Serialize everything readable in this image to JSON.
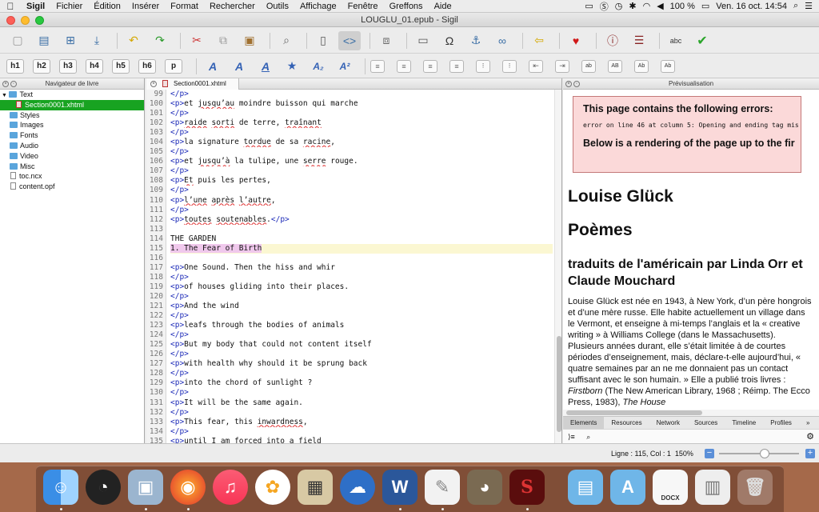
{
  "menubar": {
    "app_name": "Sigil",
    "items": [
      "Fichier",
      "Édition",
      "Insérer",
      "Format",
      "Rechercher",
      "Outils",
      "Affichage",
      "Fenêtre",
      "Greffons",
      "Aide"
    ],
    "battery": "100 %",
    "datetime": "Ven. 16 oct.  14:54"
  },
  "window": {
    "title": "LOUGLU_01.epub - Sigil"
  },
  "toolbar2": {
    "headings": [
      "h1",
      "h2",
      "h3",
      "h4",
      "h5",
      "h6",
      "p"
    ]
  },
  "book_browser": {
    "title": "Navigateur de livre",
    "items": [
      {
        "label": "Text",
        "type": "folder",
        "expanded": true
      },
      {
        "label": "Section0001.xhtml",
        "type": "file",
        "selected": true
      },
      {
        "label": "Styles",
        "type": "folder"
      },
      {
        "label": "Images",
        "type": "folder"
      },
      {
        "label": "Fonts",
        "type": "folder"
      },
      {
        "label": "Audio",
        "type": "folder"
      },
      {
        "label": "Video",
        "type": "folder"
      },
      {
        "label": "Misc",
        "type": "folder"
      },
      {
        "label": "toc.ncx",
        "type": "file"
      },
      {
        "label": "content.opf",
        "type": "file"
      }
    ]
  },
  "editor": {
    "tab_label": "Section0001.xhtml",
    "current_line": 115,
    "lines": [
      {
        "n": "99",
        "text": "</p>"
      },
      {
        "n": "100",
        "text": "<p>et jusqu’au moindre buisson qui marche"
      },
      {
        "n": "101",
        "text": "</p>"
      },
      {
        "n": "102",
        "text": "<p>raide sorti de terre, traînant"
      },
      {
        "n": "103",
        "text": "</p>"
      },
      {
        "n": "104",
        "text": "<p>la signature tordue de sa racine,"
      },
      {
        "n": "105",
        "text": "</p>"
      },
      {
        "n": "106",
        "text": "<p>et jusqu’à la tulipe, une serre rouge."
      },
      {
        "n": "107",
        "text": "</p>"
      },
      {
        "n": "108",
        "text": "<p>Et puis les pertes,"
      },
      {
        "n": "109",
        "text": "</p>"
      },
      {
        "n": "110",
        "text": "<p>l’une après l’autre,"
      },
      {
        "n": "111",
        "text": "</p>"
      },
      {
        "n": "112",
        "text": "<p>toutes soutenables.</p>"
      },
      {
        "n": "113",
        "text": ""
      },
      {
        "n": "114",
        "text": "THE GARDEN"
      },
      {
        "n": "115",
        "text": "1. The Fear of Birth"
      },
      {
        "n": "116",
        "text": ""
      },
      {
        "n": "117",
        "text": "<p>One Sound. Then the hiss and whir"
      },
      {
        "n": "118",
        "text": "</p>"
      },
      {
        "n": "119",
        "text": "<p>of houses gliding into their places."
      },
      {
        "n": "120",
        "text": "</p>"
      },
      {
        "n": "121",
        "text": "<p>And the wind"
      },
      {
        "n": "122",
        "text": "</p>"
      },
      {
        "n": "123",
        "text": "<p>leafs through the bodies of animals"
      },
      {
        "n": "124",
        "text": "</p>"
      },
      {
        "n": "125",
        "text": "<p>But my body that could not content itself"
      },
      {
        "n": "126",
        "text": "</p>"
      },
      {
        "n": "127",
        "text": "<p>with health why should it be sprung back"
      },
      {
        "n": "128",
        "text": "</p>"
      },
      {
        "n": "129",
        "text": "<p>into the chord of sunlight ?"
      },
      {
        "n": "130",
        "text": "</p>"
      },
      {
        "n": "131",
        "text": "<p>It will be the same again."
      },
      {
        "n": "132",
        "text": "</p>"
      },
      {
        "n": "133",
        "text": "<p>This fear, this inwardness,"
      },
      {
        "n": "134",
        "text": "</p>"
      },
      {
        "n": "135",
        "text": "<p>until I am forced into a field"
      }
    ]
  },
  "preview": {
    "title": "Prévisualisation",
    "error_title": "This page contains the following errors:",
    "error_message": "error on line 46 at column 5: Opening and ending tag mis",
    "error_below": "Below is a rendering of the page up to the fir",
    "h1_author": "Louise Glück",
    "h1_title": "Poèmes",
    "h2": "traduits de l'américain par Linda Orr et Claude Mouchard",
    "paragraph_start": "Louise Glück est née en 1943, à New York, d’un père hongrois et d’une mère russe. Elle habite actuellement un village dans le Vermont, et enseigne à mi-temps l’anglais et la « creative writing » à Williams College (dans le Massachusetts). Plusieurs années durant, elle s’était limitée à de courtes périodes d’enseignement, mais, déclare-t-elle aujourd’hui, « quatre semaines par an ne me donnaient pas un contact suffisant avec le son humain. » Elle a publié trois livres : ",
    "italic1": "Firstborn",
    "mid_text": " (The New American Library, 1968 ; Réimp. The Ecco Press, 1983), ",
    "italic2": "The House",
    "devtools_tabs": [
      "Elements",
      "Resources",
      "Network",
      "Sources",
      "Timeline",
      "Profiles",
      "»"
    ],
    "devtools_prompt": "⟩≡"
  },
  "statusbar": {
    "position": "Ligne : 115, Col : 1",
    "zoom": "150%"
  },
  "dock": {
    "docx_label": "DOCX"
  }
}
